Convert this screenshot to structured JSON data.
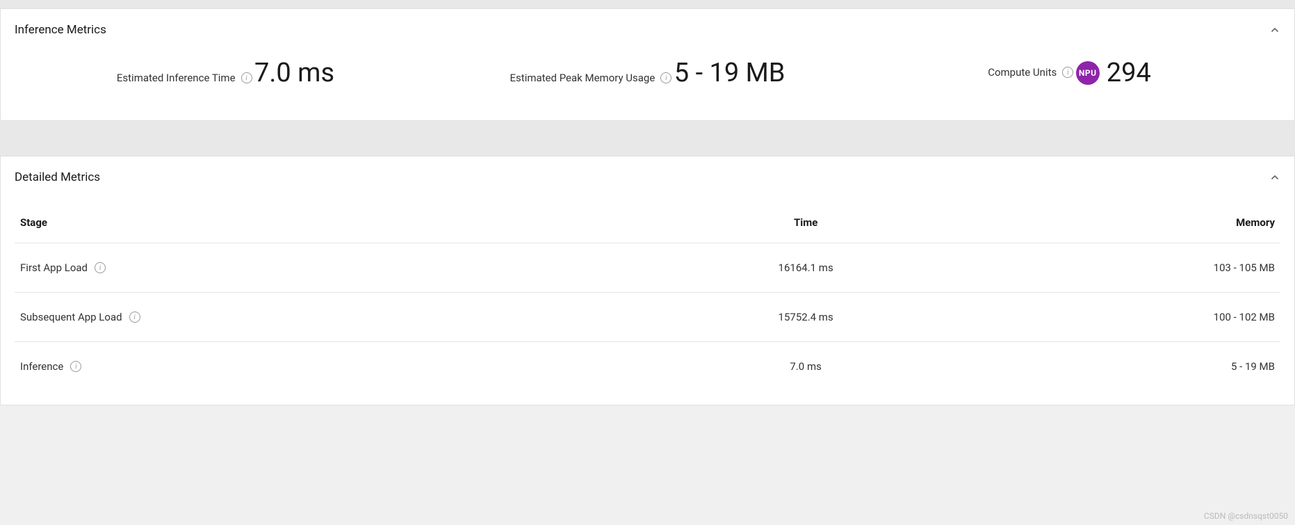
{
  "inference_panel": {
    "title": "Inference Metrics",
    "metrics": [
      {
        "label": "Estimated Inference Time",
        "value": "7.0 ms",
        "badge": null
      },
      {
        "label": "Estimated Peak Memory Usage",
        "value": "5 - 19 MB",
        "badge": null
      },
      {
        "label": "Compute Units",
        "value": "294",
        "badge": "NPU"
      }
    ]
  },
  "detailed_panel": {
    "title": "Detailed Metrics",
    "columns": {
      "stage": "Stage",
      "time": "Time",
      "memory": "Memory"
    },
    "rows": [
      {
        "stage": "First App Load",
        "info": true,
        "time": "16164.1 ms",
        "memory": "103 - 105 MB"
      },
      {
        "stage": "Subsequent App Load",
        "info": true,
        "time": "15752.4 ms",
        "memory": "100 - 102 MB"
      },
      {
        "stage": "Inference",
        "info": true,
        "time": "7.0 ms",
        "memory": "5 - 19 MB"
      }
    ]
  },
  "watermark": "CSDN @csdnsqst0050"
}
